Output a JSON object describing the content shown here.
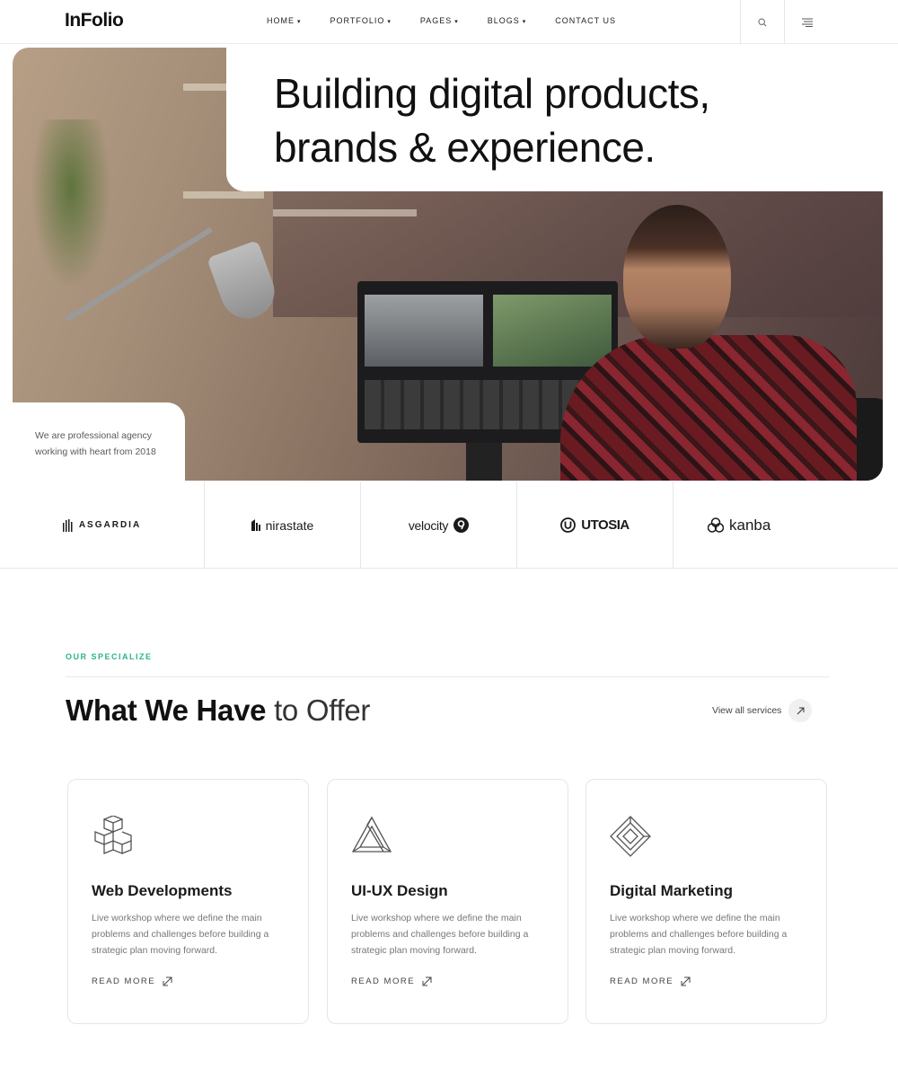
{
  "nav": {
    "logo": "InFolio",
    "menu": [
      {
        "label": "HOME",
        "caret": "▾"
      },
      {
        "label": "PORTFOLIO",
        "caret": "▾"
      },
      {
        "label": "PAGES",
        "caret": "▾"
      },
      {
        "label": "BLOGS",
        "caret": "▾"
      },
      {
        "label": "CONTACT US",
        "caret": ""
      }
    ],
    "icons": [
      "search-icon",
      "hamburger-menu-icon"
    ]
  },
  "hero": {
    "title_line1": "Building digital products,",
    "title_line2": "brands & experience.",
    "note": "We are professional agency working with heart from 2018"
  },
  "brands": [
    "ASGARDIA",
    "nirastate",
    "velocity",
    "UTOSIA",
    "kanba"
  ],
  "services": {
    "eyebrow": "OUR SPECIALIZE",
    "title_bold": "What We Have",
    "title_light": "to Offer",
    "view_all": "View all services",
    "cards": [
      {
        "title": "Web Developments",
        "desc": "Live workshop where we define the main problems and challenges before building a strategic plan moving forward.",
        "link": "READ MORE",
        "icon": "cube-grid-icon"
      },
      {
        "title": "UI-UX Design",
        "desc": "Live workshop where we define the main problems and challenges before building a strategic plan moving forward.",
        "link": "READ MORE",
        "icon": "impossible-triangle-icon"
      },
      {
        "title": "Digital Marketing",
        "desc": "Live workshop where we define the main problems and challenges before building a strategic plan moving forward.",
        "link": "READ MORE",
        "icon": "diamond-frame-icon"
      }
    ]
  },
  "colors": {
    "accent": "#2bb38f",
    "text": "#111111",
    "muted": "#777777",
    "border": "#e6e6e6"
  }
}
